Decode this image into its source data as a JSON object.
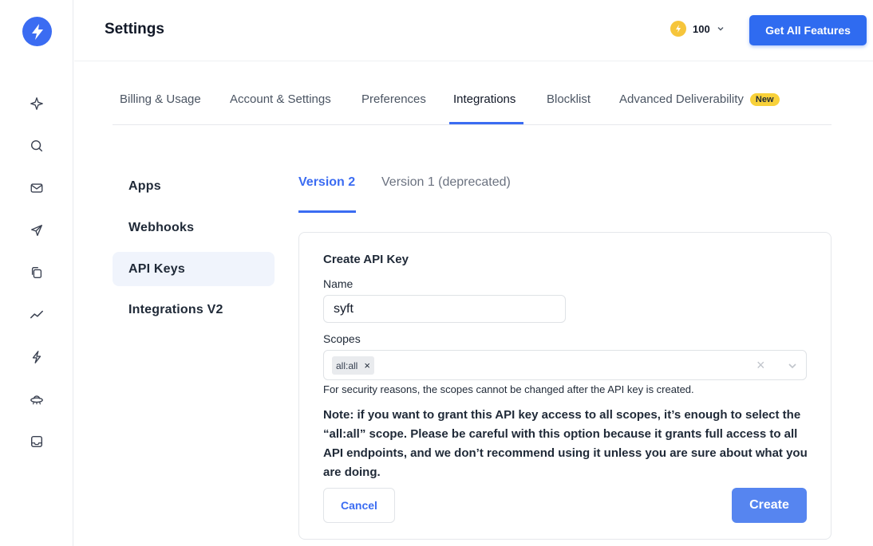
{
  "header": {
    "title": "Settings",
    "credits": "100",
    "cta_label": "Get All Features"
  },
  "rail": {
    "icons": [
      "logo-bolt-icon",
      "sparkle-icon",
      "search-icon",
      "mail-icon",
      "send-icon",
      "copy-icon",
      "trend-icon",
      "bolt-icon",
      "ufo-icon",
      "inbox-icon"
    ]
  },
  "tabs": [
    {
      "label": "Billing & Usage"
    },
    {
      "label": "Account & Settings"
    },
    {
      "label": "Preferences"
    },
    {
      "label": "Integrations",
      "active": true
    },
    {
      "label": "Blocklist"
    },
    {
      "label": "Advanced Deliverability",
      "badge": "New"
    }
  ],
  "sidenav": [
    {
      "label": "Apps"
    },
    {
      "label": "Webhooks"
    },
    {
      "label": "API Keys",
      "active": true
    },
    {
      "label": "Integrations V2"
    }
  ],
  "version_tabs": [
    {
      "label": "Version 2",
      "active": true
    },
    {
      "label": "Version 1 (deprecated)"
    }
  ],
  "form": {
    "title": "Create API Key",
    "name_label": "Name",
    "name_value": "syft",
    "scopes_label": "Scopes",
    "scope_chip": "all:all",
    "help_text": "For security reasons, the scopes cannot be changed after the API key is created.",
    "note": "Note: if you want to grant this API key access to all scopes, it’s enough to select the “all:all” scope. Please be careful with this option because it grants full access to all API endpoints, and we don’t recommend using it unless you are sure about what you are doing.",
    "cancel_label": "Cancel",
    "create_label": "Create"
  },
  "colors": {
    "accent": "#3b6cf2",
    "badge": "#f8d13a",
    "coin": "#f6c53b"
  }
}
